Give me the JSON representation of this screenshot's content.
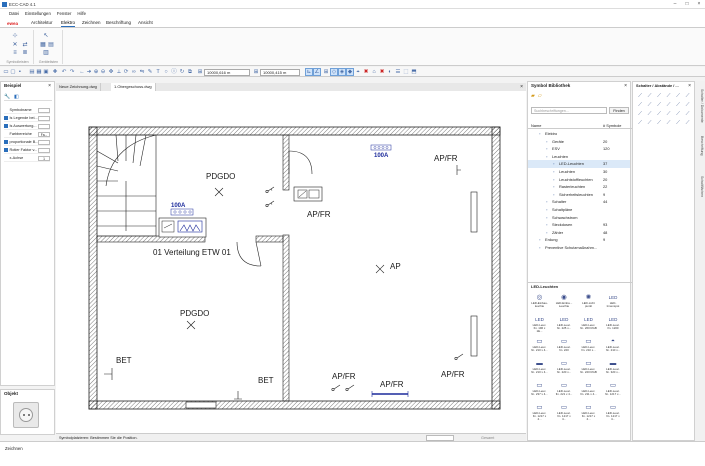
{
  "app": {
    "title": "ECC-CAD 4.1"
  },
  "menu": [
    "Datei",
    "Einstellungen",
    "Fenster",
    "Hilfe"
  ],
  "tabs": [
    {
      "label": "Architektur"
    },
    {
      "label": "Elektro"
    },
    {
      "label": "Zeichnen"
    },
    {
      "label": "Beschriftung"
    },
    {
      "label": "Ansicht"
    }
  ],
  "brand": "ewea",
  "ribbon": {
    "groups": [
      "Symbolleisten",
      "Gerätelisten"
    ]
  },
  "toolbar": {
    "coord1": "10000,616 m",
    "coord2": "10000,415 m"
  },
  "left_panel": {
    "title": "Beispiel",
    "props": [
      {
        "label": "Symbolname",
        "value": "",
        "checked": false
      },
      {
        "label": "Is Legende bei...",
        "value": "",
        "checked": true
      },
      {
        "label": "Is Auswertung...",
        "value": "",
        "checked": true
      },
      {
        "label": "Farbbereiche",
        "value": "Fa...",
        "checked": false
      },
      {
        "label": "proportionale B...",
        "value": "",
        "checked": true
      },
      {
        "label": "Rotier Faktor v...",
        "value": "",
        "checked": true
      },
      {
        "label": "x-Achse",
        "value": "1",
        "checked": false
      }
    ],
    "object_title": "Objekt"
  },
  "doc_tabs": [
    "Neue Zeichnung.dwg",
    "1.Obergeschoss.dwg"
  ],
  "plan_labels": {
    "pdgdo1": "PDGDO",
    "pdgdo2": "PDGDO",
    "apfr1": "AP/FR",
    "apfr2": "AP/FR",
    "apfr3": "AP/FR",
    "apfr4": "AP/FR",
    "apfr5": "AP/FR",
    "ap": "AP",
    "bet1": "BET",
    "bet2": "BET",
    "verteilung": "01 Verteilung ETW 01",
    "a100_1": "100A",
    "a100_2": "100A"
  },
  "status": {
    "hint": "Symbolplatzieren: Bestimmen Sie die Position.",
    "zoom": "Gesamt",
    "bottom": "Zeichnen"
  },
  "lib": {
    "title": "Symbol Bibliothek",
    "search_placeholder": "Suchbeschriftungen...",
    "search_btn": "Finden",
    "col_name": "Name",
    "col_count": "# Symbole",
    "tree": [
      {
        "label": "Elektro",
        "count": "",
        "indent": 1,
        "sel": false
      },
      {
        "label": "Geräte",
        "count": "20",
        "indent": 2,
        "sel": false
      },
      {
        "label": "ESV",
        "count": "120",
        "indent": 2,
        "sel": false
      },
      {
        "label": "Leuchten",
        "count": "",
        "indent": 2,
        "sel": false
      },
      {
        "label": "LED-Leuchten",
        "count": "37",
        "indent": 3,
        "sel": true
      },
      {
        "label": "Leuchten",
        "count": "30",
        "indent": 3,
        "sel": false
      },
      {
        "label": "Leuchtstoffleuchten",
        "count": "20",
        "indent": 3,
        "sel": false
      },
      {
        "label": "Rasterleuchten",
        "count": "22",
        "indent": 3,
        "sel": false
      },
      {
        "label": "Sicherheitsleuchten",
        "count": "9",
        "indent": 3,
        "sel": false
      },
      {
        "label": "Schalter",
        "count": "44",
        "indent": 2,
        "sel": false
      },
      {
        "label": "Schaltpläne",
        "count": "",
        "indent": 2,
        "sel": false
      },
      {
        "label": "Schwachstrom",
        "count": "",
        "indent": 2,
        "sel": false
      },
      {
        "label": "Steckdosen",
        "count": "93",
        "indent": 2,
        "sel": false
      },
      {
        "label": "Zähler",
        "count": "48",
        "indent": 2,
        "sel": false
      },
      {
        "label": "Erdung",
        "count": "9",
        "indent": 1,
        "sel": false
      },
      {
        "label": "Preventive Schutzmaßnahm...",
        "count": "",
        "indent": 1,
        "sel": false
      }
    ],
    "gallery_title": "LED-Leuchten",
    "symbols": [
      "LED-Einbau-leuchte",
      "LED-Einba. -Leuchte",
      "LED-Licht punkt",
      "LED-Innenspot",
      "LED-Leuc. fin. 196 x 1E...",
      "LED-Leuc. fin. 225 x...",
      "LED-Leuc. fin. 260 RGB",
      "LED-Leuc. fin. 1200",
      "LED-Leuc. fin. 210 x 4...",
      "LED-Leuc. fin. 220",
      "LED-Leuc. fin. 210 x...",
      "LED-Leuc. fin. 210 x...",
      "LED-Leuc. fin. 210 x 4...",
      "LED-Leuc. fin. 220 x...",
      "LED-Leuc. fin. 220 RGB",
      "LED-Leuc. fin. 320 x...",
      "LED-Leuc. fin. 237 x 4...",
      "LED-Leuc. fin. 221 x 4...",
      "LED-Leuc. fin. 211 x 4...",
      "LED-Leuc. fin. 1217 x...",
      "LED-Leuc. fin. 1217 x 4...",
      "LED-Leuc. fin. 1217 x 4...",
      "LED-Leuc. fin. 1217 x 4...",
      "LED-Leuc. fin. 1217 x 4..."
    ]
  },
  "right_panel": {
    "title": "Schalter / Abstände / ...",
    "tabs": [
      "Schalter / Dokumente",
      "Beschriftung",
      "Schaltflächen"
    ]
  },
  "colors": {
    "accent": "#2a6ebb",
    "plan_label": "#1a1a1a",
    "plan_blue": "#1b2a9b"
  }
}
